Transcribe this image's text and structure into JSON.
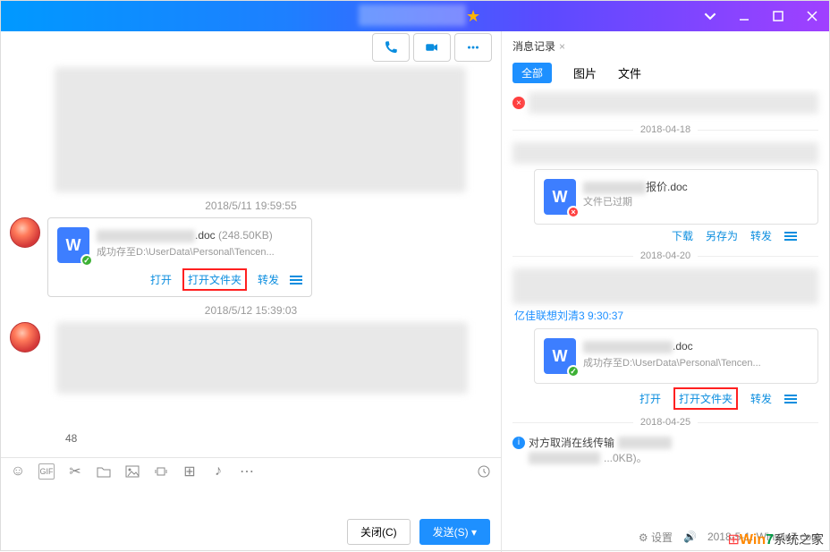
{
  "titlebar": {
    "star": "★"
  },
  "chat": {
    "ts1": "2018/5/11 19:59:55",
    "ts2": "2018/5/12 15:39:03",
    "file1": {
      "ext": ".doc",
      "size": "(248.50KB)",
      "path": "成功存至D:\\UserData\\Personal\\Tencen...",
      "open": "打开",
      "open_folder": "打开文件夹",
      "forward": "转发"
    },
    "num": "48"
  },
  "footer": {
    "close": "关闭(C)",
    "send": "发送(S)"
  },
  "history": {
    "title": "消息记录",
    "tabs": {
      "all": "全部",
      "image": "图片",
      "file": "文件"
    },
    "d1": "2018-04-18",
    "d2": "2018-04-20",
    "d3": "2018-04-25",
    "f1": {
      "name_suffix": "报价.doc",
      "expired": "文件已过期",
      "download": "下载",
      "saveas": "另存为",
      "forward": "转发"
    },
    "sender": "亿佳联想刘清3 9:30:37",
    "f2": {
      "ext": ".doc",
      "path": "成功存至D:\\UserData\\Personal\\Tencen...",
      "open": "打开",
      "open_folder": "打开文件夹",
      "forward": "转发"
    },
    "cancel_msg": "对方取消在线传输",
    "size2": "...0KB)。"
  },
  "status": {
    "settings": "设置",
    "date": "2018-5-1..Winwin7.com"
  },
  "brand": {
    "win": "Win",
    "seven": "7",
    "cn": "系统之家"
  }
}
